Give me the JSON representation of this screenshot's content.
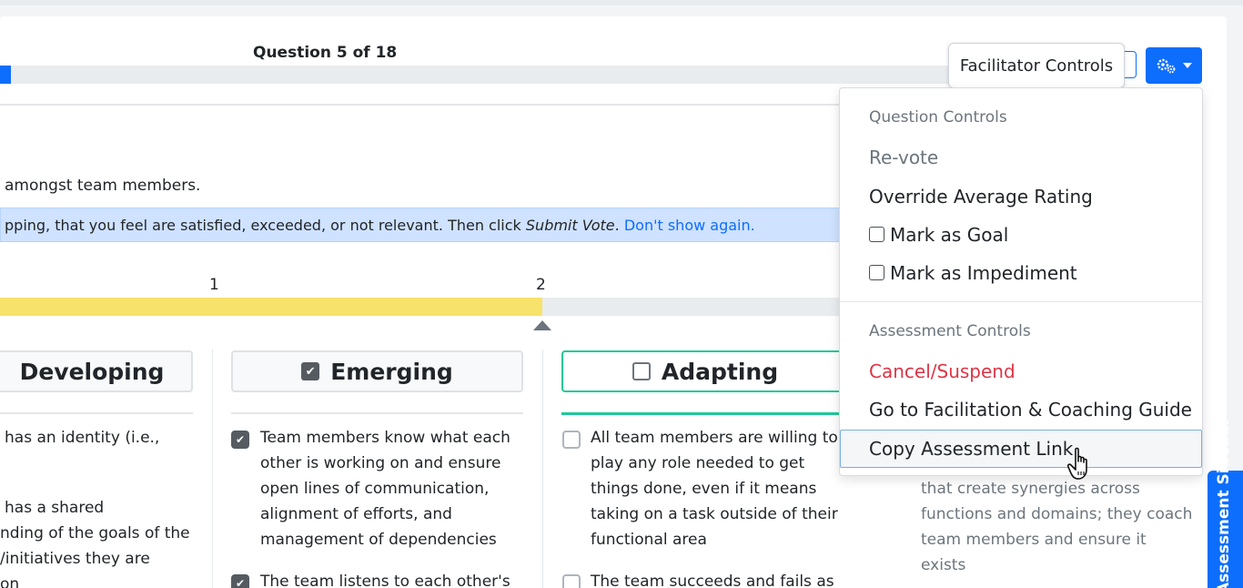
{
  "header": {
    "question_label": "Question 5 of 18",
    "question_progress_percent": 1.1
  },
  "question": {
    "description_fragment": "amongst team members.",
    "instruction": {
      "text_before": "pping, that you feel are satisfied, exceeded, or not relevant. Then click ",
      "emphasis": "Submit Vote",
      "text_after": ". ",
      "link": "Don't show again."
    }
  },
  "scale": {
    "labels": [
      "1",
      "2"
    ],
    "current_value": 2
  },
  "stages": [
    {
      "label": "Developing",
      "checked": false
    },
    {
      "label": "Emerging",
      "checked": true
    },
    {
      "label": "Adapting",
      "checked": false
    }
  ],
  "items": {
    "developing": [
      "has an identity (i.e.,",
      "has a shared",
      "nding of the goals of the",
      "/initiatives they are",
      "on"
    ],
    "emerging": [
      "Team members know what each other is working on and ensure open lines of communication, alignment of efforts, and management of dependencies",
      "The team listens to each other's"
    ],
    "adapting": [
      "All team members are willing to play any role needed to get things done, even if it means taking on a task outside of their functional area",
      "The team succeeds and fails as"
    ],
    "fourth": "that create synergies across functions and domains; they coach team members and ensure it exists"
  },
  "facilitator": {
    "tooltip": "Facilitator Controls",
    "gear_icon": "gears-icon",
    "dropdown_icon": "caret-down-icon"
  },
  "menu": {
    "question_header": "Question Controls",
    "revote": "Re-vote",
    "override": "Override Average Rating",
    "mark_goal": "Mark as Goal",
    "mark_impediment": "Mark as Impediment",
    "assessment_header": "Assessment Controls",
    "cancel": "Cancel/Suspend",
    "guide": "Go to Facilitation & Coaching Guide",
    "copy_link": "Copy Assessment Link"
  },
  "sidebar": {
    "label": "Assessment Sidebar"
  },
  "colors": {
    "primary": "#0d6efd",
    "scale_fill": "#f7e26b",
    "active_stage": "#20c997",
    "danger": "#dc3545"
  }
}
